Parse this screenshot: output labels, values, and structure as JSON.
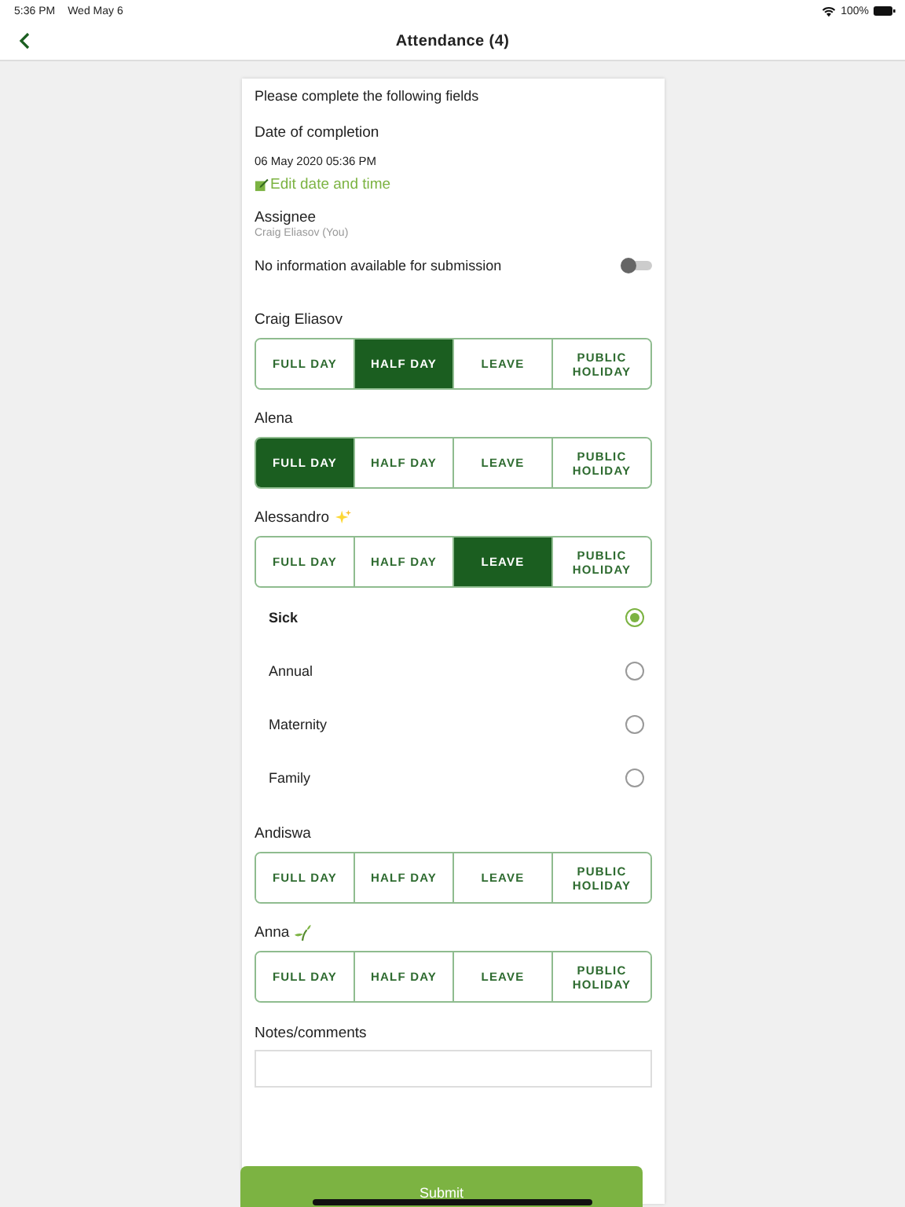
{
  "status_bar": {
    "time": "5:36 PM",
    "date": "Wed May 6",
    "battery": "100%"
  },
  "nav": {
    "title": "Attendance (4)"
  },
  "form": {
    "intro": "Please complete the following fields",
    "completion": {
      "label": "Date of completion",
      "value": "06 May 2020 05:36 PM",
      "edit_link": "Edit date and time"
    },
    "assignee": {
      "label": "Assignee",
      "value": "Craig Eliasov (You)"
    },
    "no_info": {
      "label": "No information available for submission",
      "on": false
    },
    "people": [
      {
        "name": "Craig Eliasov",
        "kind": "plain",
        "options": [
          {
            "label": "FULL DAY",
            "selected": false
          },
          {
            "label": "HALF DAY",
            "selected": true
          },
          {
            "label": "LEAVE",
            "selected": false
          },
          {
            "label": "PUBLIC HOLIDAY",
            "selected": false
          }
        ]
      },
      {
        "name": "Alena",
        "kind": "plain",
        "options": [
          {
            "label": "FULL DAY",
            "selected": true
          },
          {
            "label": "HALF DAY",
            "selected": false
          },
          {
            "label": "LEAVE",
            "selected": false
          },
          {
            "label": "PUBLIC HOLIDAY",
            "selected": false
          }
        ]
      },
      {
        "name": "Alessandro",
        "kind": "sparkles",
        "options": [
          {
            "label": "FULL DAY",
            "selected": false
          },
          {
            "label": "HALF DAY",
            "selected": false
          },
          {
            "label": "LEAVE",
            "selected": true
          },
          {
            "label": "PUBLIC HOLIDAY",
            "selected": false
          }
        ],
        "leave_types": [
          {
            "label": "Sick",
            "selected": true
          },
          {
            "label": "Annual",
            "selected": false
          },
          {
            "label": "Maternity",
            "selected": false
          },
          {
            "label": "Family",
            "selected": false
          }
        ]
      },
      {
        "name": "Andiswa",
        "kind": "plain",
        "options": [
          {
            "label": "FULL DAY",
            "selected": false
          },
          {
            "label": "HALF DAY",
            "selected": false
          },
          {
            "label": "LEAVE",
            "selected": false
          },
          {
            "label": "PUBLIC HOLIDAY",
            "selected": false
          }
        ]
      },
      {
        "name": "Anna",
        "kind": "sprout",
        "options": [
          {
            "label": "FULL DAY",
            "selected": false
          },
          {
            "label": "HALF DAY",
            "selected": false
          },
          {
            "label": "LEAVE",
            "selected": false
          },
          {
            "label": "PUBLIC HOLIDAY",
            "selected": false
          }
        ]
      }
    ],
    "notes": {
      "label": "Notes/comments"
    },
    "submit": "Submit"
  }
}
